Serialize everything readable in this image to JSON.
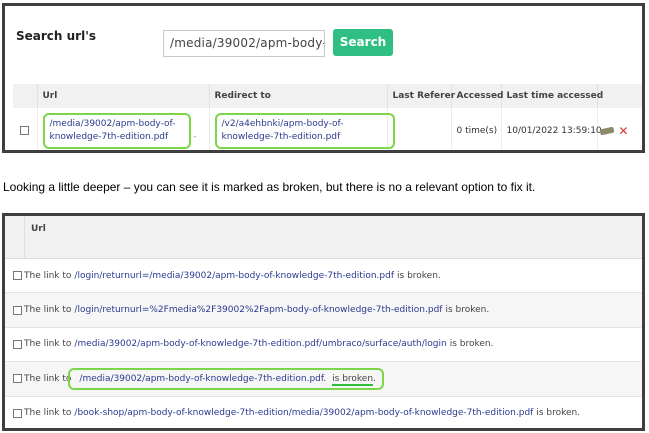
{
  "search": {
    "label": "Search url's",
    "input_value": "/media/39002/apm-body-o",
    "button_label": "Search"
  },
  "table1": {
    "headers": [
      "Url",
      "Redirect to",
      "Last Referer",
      "Accessed",
      "Last time accessed"
    ],
    "row": {
      "url": "/media/39002/apm-body-of-knowledge-7th-edition.pdf",
      "dash": "-",
      "redirect": "/v2/a4ehbnki/apm-body-of-knowledge-7th-edition.pdf",
      "last_referer": "",
      "accessed": "0 time(s)",
      "last_time": "10/01/2022 13:59:10"
    }
  },
  "caption": "Looking a little deeper – you can see it is marked as broken, but there is no a relevant option to fix it.",
  "table2": {
    "header": "Url",
    "prefix": "The link to",
    "suffix": "is broken.",
    "rows": [
      {
        "url": "/login/returnurl=/media/39002/apm-body-of-knowledge-7th-edition.pdf"
      },
      {
        "url": "/login/returnurl=%2Fmedia%2F39002%2Fapm-body-of-knowledge-7th-edition.pdf"
      },
      {
        "url": "/media/39002/apm-body-of-knowledge-7th-edition.pdf/umbraco/surface/auth/login"
      },
      {
        "url": "/media/39002/apm-body-of-knowledge-7th-edition.pdf.",
        "highlight_suffix": "is broken"
      },
      {
        "url": "/book-shop/apm-body-of-knowledge-7th-edition/media/39002/apm-body-of-knowledge-7th-edition.pdf"
      }
    ]
  },
  "colors": {
    "search_button": "#2fbf82",
    "highlight": "#7bd64a",
    "link": "#2b3a8f",
    "delete": "#dd3333"
  }
}
